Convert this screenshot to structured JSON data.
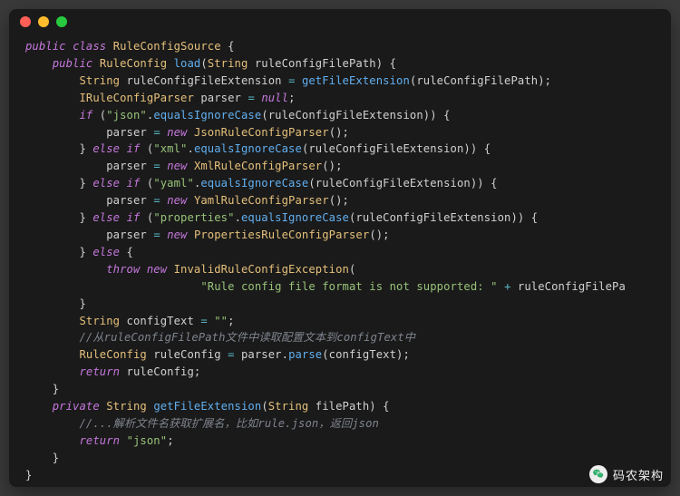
{
  "window": {
    "dots": [
      "close",
      "minimize",
      "zoom"
    ]
  },
  "code": {
    "lines": [
      [
        [
          "kw",
          "public"
        ],
        [
          "pl",
          " "
        ],
        [
          "kw",
          "class"
        ],
        [
          "pl",
          " "
        ],
        [
          "type",
          "RuleConfigSource"
        ],
        [
          "pl",
          " {"
        ]
      ],
      [
        [
          "pl",
          "    "
        ],
        [
          "kw",
          "public"
        ],
        [
          "pl",
          " "
        ],
        [
          "type",
          "RuleConfig"
        ],
        [
          "pl",
          " "
        ],
        [
          "fn",
          "load"
        ],
        [
          "pl",
          "("
        ],
        [
          "type",
          "String"
        ],
        [
          "pl",
          " ruleConfigFilePath) {"
        ]
      ],
      [
        [
          "pl",
          "        "
        ],
        [
          "type",
          "String"
        ],
        [
          "pl",
          " ruleConfigFileExtension "
        ],
        [
          "op",
          "="
        ],
        [
          "pl",
          " "
        ],
        [
          "fn",
          "getFileExtension"
        ],
        [
          "pl",
          "(ruleConfigFilePath);"
        ]
      ],
      [
        [
          "pl",
          "        "
        ],
        [
          "type",
          "IRuleConfigParser"
        ],
        [
          "pl",
          " parser "
        ],
        [
          "op",
          "="
        ],
        [
          "pl",
          " "
        ],
        [
          "kw",
          "null"
        ],
        [
          "pl",
          ";"
        ]
      ],
      [
        [
          "pl",
          "        "
        ],
        [
          "kw",
          "if"
        ],
        [
          "pl",
          " ("
        ],
        [
          "str",
          "\"json\""
        ],
        [
          "pl",
          "."
        ],
        [
          "fn",
          "equalsIgnoreCase"
        ],
        [
          "pl",
          "(ruleConfigFileExtension)) {"
        ]
      ],
      [
        [
          "pl",
          "            parser "
        ],
        [
          "op",
          "="
        ],
        [
          "pl",
          " "
        ],
        [
          "kw",
          "new"
        ],
        [
          "pl",
          " "
        ],
        [
          "type",
          "JsonRuleConfigParser"
        ],
        [
          "pl",
          "();"
        ]
      ],
      [
        [
          "pl",
          "        } "
        ],
        [
          "kw",
          "else"
        ],
        [
          "pl",
          " "
        ],
        [
          "kw",
          "if"
        ],
        [
          "pl",
          " ("
        ],
        [
          "str",
          "\"xml\""
        ],
        [
          "pl",
          "."
        ],
        [
          "fn",
          "equalsIgnoreCase"
        ],
        [
          "pl",
          "(ruleConfigFileExtension)) {"
        ]
      ],
      [
        [
          "pl",
          "            parser "
        ],
        [
          "op",
          "="
        ],
        [
          "pl",
          " "
        ],
        [
          "kw",
          "new"
        ],
        [
          "pl",
          " "
        ],
        [
          "type",
          "XmlRuleConfigParser"
        ],
        [
          "pl",
          "();"
        ]
      ],
      [
        [
          "pl",
          "        } "
        ],
        [
          "kw",
          "else"
        ],
        [
          "pl",
          " "
        ],
        [
          "kw",
          "if"
        ],
        [
          "pl",
          " ("
        ],
        [
          "str",
          "\"yaml\""
        ],
        [
          "pl",
          "."
        ],
        [
          "fn",
          "equalsIgnoreCase"
        ],
        [
          "pl",
          "(ruleConfigFileExtension)) {"
        ]
      ],
      [
        [
          "pl",
          "            parser "
        ],
        [
          "op",
          "="
        ],
        [
          "pl",
          " "
        ],
        [
          "kw",
          "new"
        ],
        [
          "pl",
          " "
        ],
        [
          "type",
          "YamlRuleConfigParser"
        ],
        [
          "pl",
          "();"
        ]
      ],
      [
        [
          "pl",
          "        } "
        ],
        [
          "kw",
          "else"
        ],
        [
          "pl",
          " "
        ],
        [
          "kw",
          "if"
        ],
        [
          "pl",
          " ("
        ],
        [
          "str",
          "\"properties\""
        ],
        [
          "pl",
          "."
        ],
        [
          "fn",
          "equalsIgnoreCase"
        ],
        [
          "pl",
          "(ruleConfigFileExtension)) {"
        ]
      ],
      [
        [
          "pl",
          "            parser "
        ],
        [
          "op",
          "="
        ],
        [
          "pl",
          " "
        ],
        [
          "kw",
          "new"
        ],
        [
          "pl",
          " "
        ],
        [
          "type",
          "PropertiesRuleConfigParser"
        ],
        [
          "pl",
          "();"
        ]
      ],
      [
        [
          "pl",
          "        } "
        ],
        [
          "kw",
          "else"
        ],
        [
          "pl",
          " {"
        ]
      ],
      [
        [
          "pl",
          "            "
        ],
        [
          "kw",
          "throw"
        ],
        [
          "pl",
          " "
        ],
        [
          "kw",
          "new"
        ],
        [
          "pl",
          " "
        ],
        [
          "type",
          "InvalidRuleConfigException"
        ],
        [
          "pl",
          "("
        ]
      ],
      [
        [
          "pl",
          "                          "
        ],
        [
          "str",
          "\"Rule config file format is not supported: \""
        ],
        [
          "pl",
          " "
        ],
        [
          "op",
          "+"
        ],
        [
          "pl",
          " ruleConfigFilePa"
        ]
      ],
      [
        [
          "pl",
          "        }"
        ]
      ],
      [
        [
          "pl",
          "        "
        ],
        [
          "type",
          "String"
        ],
        [
          "pl",
          " configText "
        ],
        [
          "op",
          "="
        ],
        [
          "pl",
          " "
        ],
        [
          "str",
          "\"\""
        ],
        [
          "pl",
          ";"
        ]
      ],
      [
        [
          "pl",
          "        "
        ],
        [
          "cmt",
          "//从ruleConfigFilePath文件中读取配置文本到configText中"
        ]
      ],
      [
        [
          "pl",
          "        "
        ],
        [
          "type",
          "RuleConfig"
        ],
        [
          "pl",
          " ruleConfig "
        ],
        [
          "op",
          "="
        ],
        [
          "pl",
          " parser."
        ],
        [
          "fn",
          "parse"
        ],
        [
          "pl",
          "(configText);"
        ]
      ],
      [
        [
          "pl",
          "        "
        ],
        [
          "kw",
          "return"
        ],
        [
          "pl",
          " ruleConfig;"
        ]
      ],
      [
        [
          "pl",
          "    }"
        ]
      ],
      [
        [
          "pl",
          ""
        ]
      ],
      [
        [
          "pl",
          "    "
        ],
        [
          "kw",
          "private"
        ],
        [
          "pl",
          " "
        ],
        [
          "type",
          "String"
        ],
        [
          "pl",
          " "
        ],
        [
          "fn",
          "getFileExtension"
        ],
        [
          "pl",
          "("
        ],
        [
          "type",
          "String"
        ],
        [
          "pl",
          " filePath) {"
        ]
      ],
      [
        [
          "pl",
          "        "
        ],
        [
          "cmt",
          "//...解析文件名获取扩展名，比如rule.json，返回json"
        ]
      ],
      [
        [
          "pl",
          "        "
        ],
        [
          "kw",
          "return"
        ],
        [
          "pl",
          " "
        ],
        [
          "str",
          "\"json\""
        ],
        [
          "pl",
          ";"
        ]
      ],
      [
        [
          "pl",
          "    }"
        ]
      ],
      [
        [
          "pl",
          "}"
        ]
      ]
    ]
  },
  "watermark": {
    "text": "码农架构"
  }
}
